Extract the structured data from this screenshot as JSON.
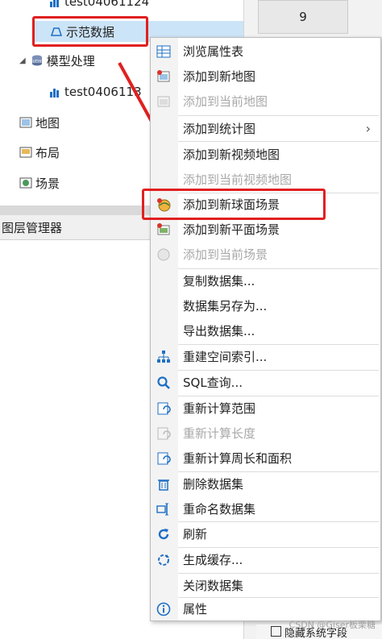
{
  "tree": {
    "top_partial": "test04061124",
    "items": [
      {
        "label": "示范数据",
        "selected": true
      },
      {
        "label": "模型处理"
      },
      {
        "label": "test0406113"
      },
      {
        "label": "地图"
      },
      {
        "label": "布局"
      },
      {
        "label": "场景"
      }
    ]
  },
  "layer_manager": {
    "title": "图层管理器"
  },
  "right_panel": {
    "cell_value": "9",
    "bottom_text": "隐藏系统字段"
  },
  "context_menu": {
    "items": [
      {
        "label": "浏览属性表",
        "icon": "table-icon"
      },
      {
        "label": "添加到新地图",
        "icon": "new-map-icon"
      },
      {
        "label": "添加到当前地图",
        "icon": "current-map-icon",
        "disabled": true
      },
      {
        "label": "添加到统计图",
        "icon": "none",
        "submenu": true
      },
      {
        "label": "添加到新视频地图",
        "icon": "none"
      },
      {
        "label": "添加到当前视频地图",
        "icon": "none",
        "disabled": true
      },
      {
        "label": "添加到新球面场景",
        "icon": "globe-scene-icon"
      },
      {
        "label": "添加到新平面场景",
        "icon": "plane-scene-icon"
      },
      {
        "label": "添加到当前场景",
        "icon": "current-scene-icon",
        "disabled": true
      },
      {
        "label": "复制数据集...",
        "icon": "none"
      },
      {
        "label": "数据集另存为...",
        "icon": "none"
      },
      {
        "label": "导出数据集...",
        "icon": "none"
      },
      {
        "label": "重建空间索引...",
        "icon": "index-tree-icon"
      },
      {
        "label": "SQL查询...",
        "icon": "search-icon"
      },
      {
        "label": "重新计算范围",
        "icon": "recalc-range-icon"
      },
      {
        "label": "重新计算长度",
        "icon": "recalc-length-icon",
        "disabled": true
      },
      {
        "label": "重新计算周长和面积",
        "icon": "recalc-area-icon"
      },
      {
        "label": "删除数据集",
        "icon": "trash-icon"
      },
      {
        "label": "重命名数据集",
        "icon": "rename-icon"
      },
      {
        "label": "刷新",
        "icon": "refresh-icon"
      },
      {
        "label": "生成缓存...",
        "icon": "cache-icon"
      },
      {
        "label": "关闭数据集",
        "icon": "none"
      },
      {
        "label": "属性",
        "icon": "info-icon"
      }
    ]
  },
  "colors": {
    "highlight": "#e02020",
    "selection": "#cce4f7",
    "icon_blue": "#1e6fc4",
    "icon_red": "#d9342b"
  },
  "watermark": "CSDN @Giser板栗糖"
}
